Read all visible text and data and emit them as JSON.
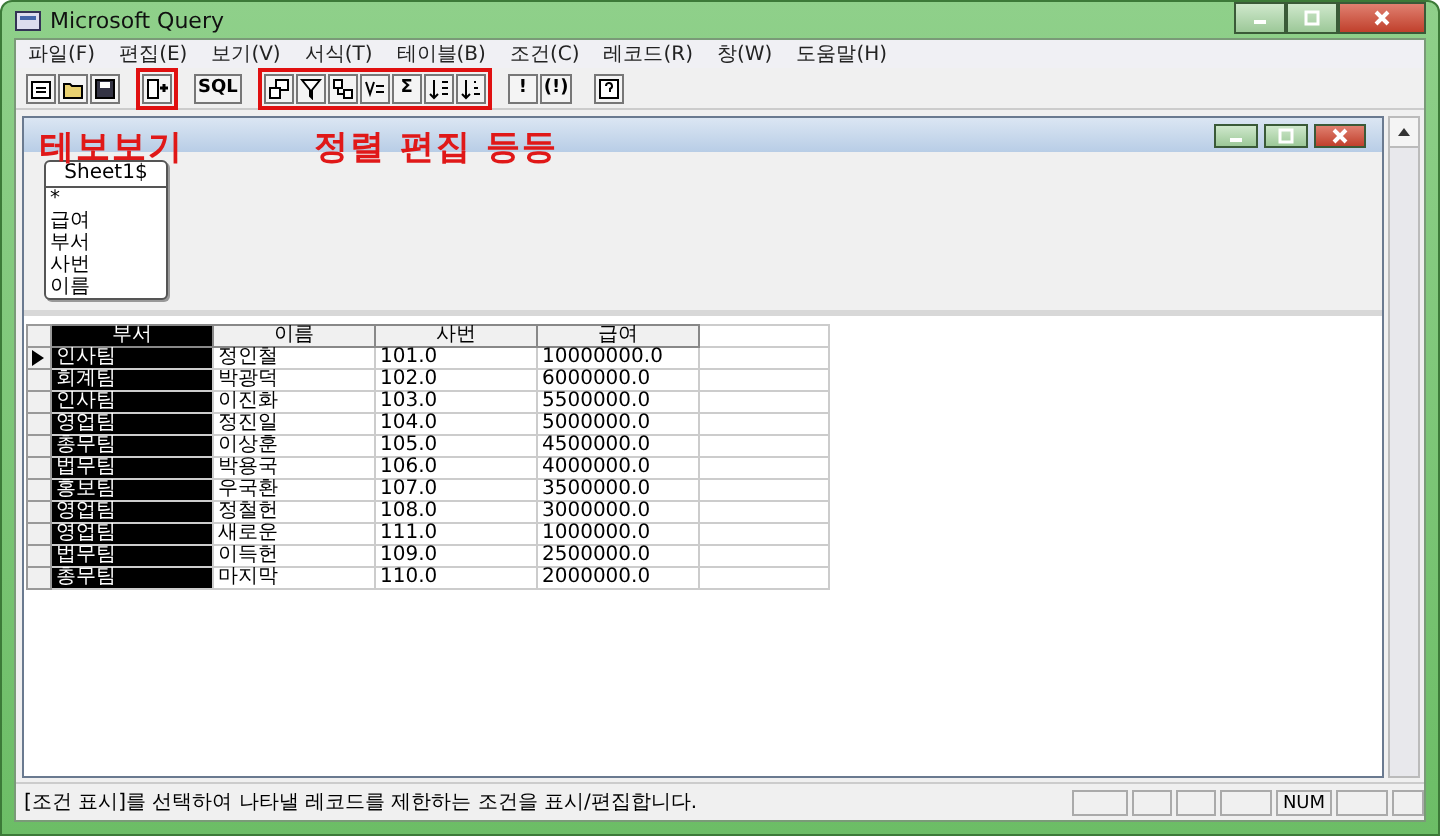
{
  "window": {
    "title": "Microsoft Query"
  },
  "menu": [
    "파일(F)",
    "편집(E)",
    "보기(V)",
    "서식(T)",
    "테이블(B)",
    "조건(C)",
    "레코드(R)",
    "창(W)",
    "도움말(H)"
  ],
  "toolbar": [
    {
      "highlighted": false,
      "buttons": [
        {
          "kind": "new"
        },
        {
          "kind": "open"
        },
        {
          "kind": "save"
        }
      ]
    },
    {
      "highlighted": true,
      "buttons": [
        {
          "kind": "addtable"
        }
      ]
    },
    {
      "highlighted": false,
      "buttons": [
        {
          "kind": "text",
          "label": "SQL"
        }
      ]
    },
    {
      "highlighted": true,
      "buttons": [
        {
          "kind": "tables"
        },
        {
          "kind": "criteria"
        },
        {
          "kind": "link"
        },
        {
          "kind": "filter"
        },
        {
          "kind": "text",
          "label": "Σ"
        },
        {
          "kind": "sortasc"
        },
        {
          "kind": "sortdesc"
        }
      ]
    },
    {
      "highlighted": false,
      "buttons": [
        {
          "kind": "text",
          "label": "!"
        },
        {
          "kind": "text",
          "label": "(!)"
        }
      ]
    },
    {
      "highlighted": false,
      "buttons": [
        {
          "kind": "help"
        }
      ]
    }
  ],
  "annotations": [
    "테보보기",
    "정렬 편집 등등"
  ],
  "table": {
    "name": "Sheet1$",
    "fields": [
      "*",
      "급여",
      "부서",
      "사번",
      "이름"
    ]
  },
  "grid": {
    "columns": [
      {
        "label": "부서",
        "selected": true
      },
      {
        "label": "이름",
        "selected": false
      },
      {
        "label": "사번",
        "selected": false
      },
      {
        "label": "급여",
        "selected": false
      }
    ],
    "rows": [
      {
        "current": true,
        "cells": [
          "인사팀",
          "정인철",
          "101.0",
          "10000000.0"
        ]
      },
      {
        "current": false,
        "cells": [
          "회계팀",
          "박광덕",
          "102.0",
          "6000000.0"
        ]
      },
      {
        "current": false,
        "cells": [
          "인사팀",
          "이진화",
          "103.0",
          "5500000.0"
        ]
      },
      {
        "current": false,
        "cells": [
          "영업팀",
          "정진일",
          "104.0",
          "5000000.0"
        ]
      },
      {
        "current": false,
        "cells": [
          "총무팀",
          "이상훈",
          "105.0",
          "4500000.0"
        ]
      },
      {
        "current": false,
        "cells": [
          "법무팀",
          "박용국",
          "106.0",
          "4000000.0"
        ]
      },
      {
        "current": false,
        "cells": [
          "홍보팀",
          "우국환",
          "107.0",
          "3500000.0"
        ]
      },
      {
        "current": false,
        "cells": [
          "영업팀",
          "정철헌",
          "108.0",
          "3000000.0"
        ]
      },
      {
        "current": false,
        "cells": [
          "영업팀",
          "새로운",
          "111.0",
          "1000000.0"
        ]
      },
      {
        "current": false,
        "cells": [
          "법무팀",
          "이득헌",
          "109.0",
          "2500000.0"
        ]
      },
      {
        "current": false,
        "cells": [
          "총무팀",
          "마지막",
          "110.0",
          "2000000.0"
        ]
      }
    ]
  },
  "status": {
    "message": "[조건 표시]를 선택하여 나타낼 레코드를 제한하는 조건을 표시/편집합니다.",
    "indicator": "NUM"
  }
}
